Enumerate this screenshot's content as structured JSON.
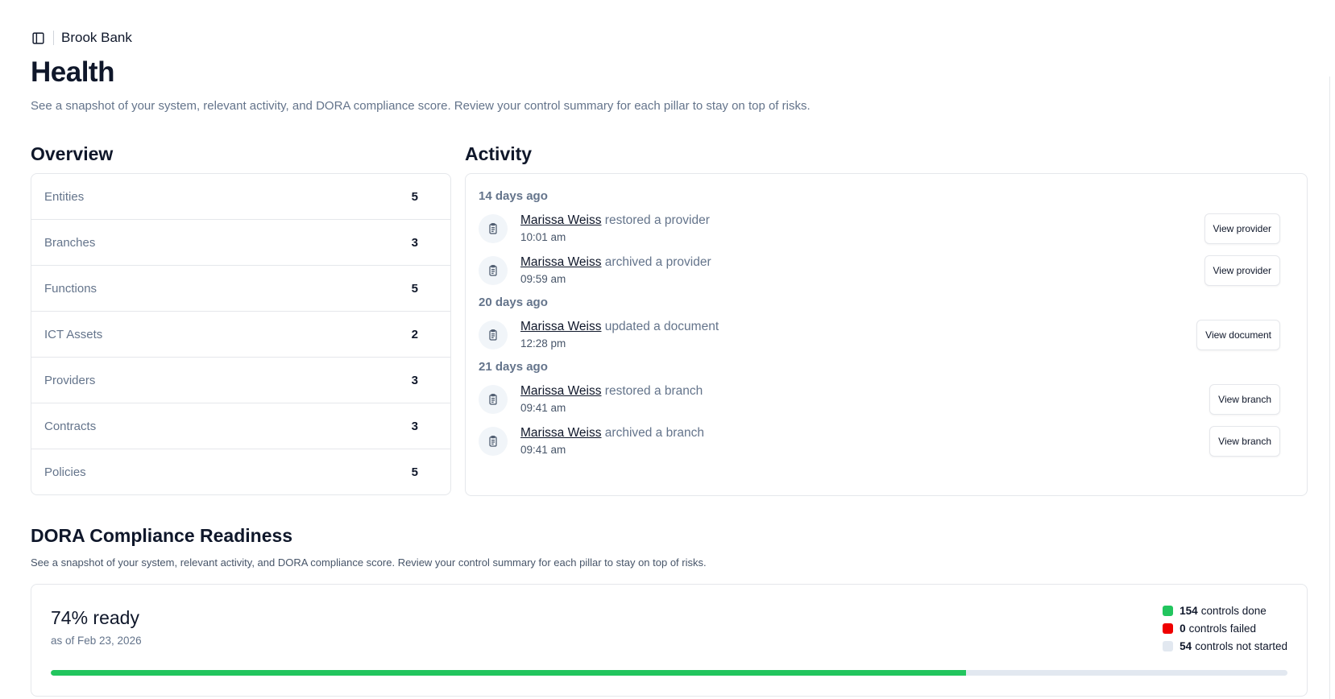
{
  "org": {
    "name": "Brook Bank"
  },
  "page": {
    "title": "Health",
    "subtitle": "See a snapshot of your system, relevant activity, and DORA compliance score. Review your control summary for each pillar to stay on top of risks."
  },
  "overview": {
    "title": "Overview",
    "rows": [
      {
        "label": "Entities",
        "value": "5"
      },
      {
        "label": "Branches",
        "value": "3"
      },
      {
        "label": "Functions",
        "value": "5"
      },
      {
        "label": "ICT Assets",
        "value": "2"
      },
      {
        "label": "Providers",
        "value": "3"
      },
      {
        "label": "Contracts",
        "value": "3"
      },
      {
        "label": "Policies",
        "value": "5"
      }
    ]
  },
  "activity": {
    "title": "Activity",
    "groups": [
      {
        "day": "14 days ago",
        "items": [
          {
            "user": "Marissa Weiss",
            "action": " restored a provider",
            "time": "10:01 am",
            "button": "View provider"
          },
          {
            "user": "Marissa Weiss",
            "action": " archived a provider",
            "time": "09:59 am",
            "button": "View provider"
          }
        ]
      },
      {
        "day": "20 days ago",
        "items": [
          {
            "user": "Marissa Weiss",
            "action": " updated a document",
            "time": "12:28 pm",
            "button": "View document"
          }
        ]
      },
      {
        "day": "21 days ago",
        "items": [
          {
            "user": "Marissa Weiss",
            "action": " restored a branch",
            "time": "09:41 am",
            "button": "View branch"
          },
          {
            "user": "Marissa Weiss",
            "action": " archived a branch",
            "time": "09:41 am",
            "button": "View branch"
          }
        ]
      }
    ]
  },
  "dora": {
    "title": "DORA Compliance Readiness",
    "subtitle": "See a snapshot of your system, relevant activity, and DORA compliance score. Review your control summary for each pillar to stay on top of risks.",
    "ready_label": "74% ready",
    "as_of": "as of Feb 23, 2026",
    "progress_fraction": 0.74,
    "legend": [
      {
        "count": "154",
        "label": "controls done",
        "color": "#22c55e"
      },
      {
        "count": "0",
        "label": "controls failed",
        "color": "#ef0000"
      },
      {
        "count": "54",
        "label": "controls not started",
        "color": "#e2e8f0"
      }
    ],
    "progress_color": "#22c55e"
  }
}
